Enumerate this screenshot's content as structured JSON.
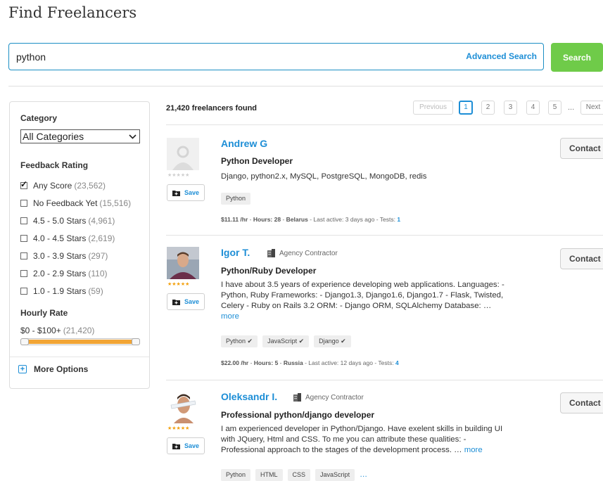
{
  "page": {
    "title": "Find Freelancers"
  },
  "search": {
    "value": "python",
    "advanced_label": "Advanced Search",
    "button_label": "Search"
  },
  "sidebar": {
    "category_label": "Category",
    "category_selected": "All Categories",
    "feedback_label": "Feedback Rating",
    "feedback_options": [
      {
        "label": "Any Score",
        "count": "(23,562)",
        "checked": true
      },
      {
        "label": "No Feedback Yet",
        "count": "(15,516)",
        "checked": false
      },
      {
        "label": "4.5 - 5.0 Stars",
        "count": "(4,961)",
        "checked": false
      },
      {
        "label": "4.0 - 4.5 Stars",
        "count": "(2,619)",
        "checked": false
      },
      {
        "label": "3.0 - 3.9 Stars",
        "count": "(297)",
        "checked": false
      },
      {
        "label": "2.0 - 2.9 Stars",
        "count": "(110)",
        "checked": false
      },
      {
        "label": "1.0 - 1.9 Stars",
        "count": "(59)",
        "checked": false
      }
    ],
    "hourly_label": "Hourly Rate",
    "hourly_range": "$0 - $100+",
    "hourly_count": "(21,420)",
    "more_options_label": "More Options"
  },
  "results": {
    "found_text": "21,420 freelancers found",
    "pagination": {
      "previous": "Previous",
      "pages": [
        "1",
        "2",
        "3",
        "4",
        "5"
      ],
      "ellipsis": "...",
      "next": "Next",
      "current": "1"
    },
    "freelancers": [
      {
        "name": "Andrew G",
        "title": "Python Developer",
        "description": "Django, python2.x, MySQL, PostgreSQL, MongoDB, redis",
        "tags": [
          "Python"
        ],
        "rate": "$11.11 /hr",
        "hours_label": "Hours:",
        "hours": "28",
        "country": "Belarus",
        "last_active_label": "Last active:",
        "last_active": "3 days ago",
        "tests_label": "Tests:",
        "tests": "1",
        "save_label": "Save",
        "contact_label": "Contact",
        "stars": "★★★★★"
      },
      {
        "name": "Igor T.",
        "agency_label": "Agency Contractor",
        "title": "Python/Ruby Developer",
        "description": "I have about 3.5 years of experience developing web applications. Languages: - Python, Ruby Frameworks: - Django1.3, Django1.6, Django1.7   - Flask, Twisted, Celery - Ruby on Rails 3.2 ORM: - Django ORM, SQLAlchemy Database: …",
        "more_label": "more",
        "tags": [
          "Python ✔",
          "JavaScript ✔",
          "Django ✔"
        ],
        "rate": "$22.00 /hr",
        "hours_label": "Hours:",
        "hours": "5",
        "country": "Russia",
        "last_active_label": "Last active:",
        "last_active": "12 days ago",
        "tests_label": "Tests:",
        "tests": "4",
        "save_label": "Save",
        "contact_label": "Contact",
        "stars": "★★★★★"
      },
      {
        "name": "Oleksandr I.",
        "agency_label": "Agency Contractor",
        "title": "Professional python/django developer",
        "description": "I am experienced developer in Python/Django. Have exelent skills in building UI with JQuery, Html and CSS. To me you can attribute these qualities:   - Professional approach to the stages of the development process. …",
        "more_label": "more",
        "tags": [
          "Python",
          "HTML",
          "CSS",
          "JavaScript"
        ],
        "tags_more": "…",
        "save_label": "Save",
        "contact_label": "Contact",
        "stars": "★★★★★"
      }
    ]
  },
  "colors": {
    "accent": "#1d8ed6",
    "search_button": "#6fcb49",
    "slider": "#f2a535",
    "stars": "#f3a00d"
  }
}
